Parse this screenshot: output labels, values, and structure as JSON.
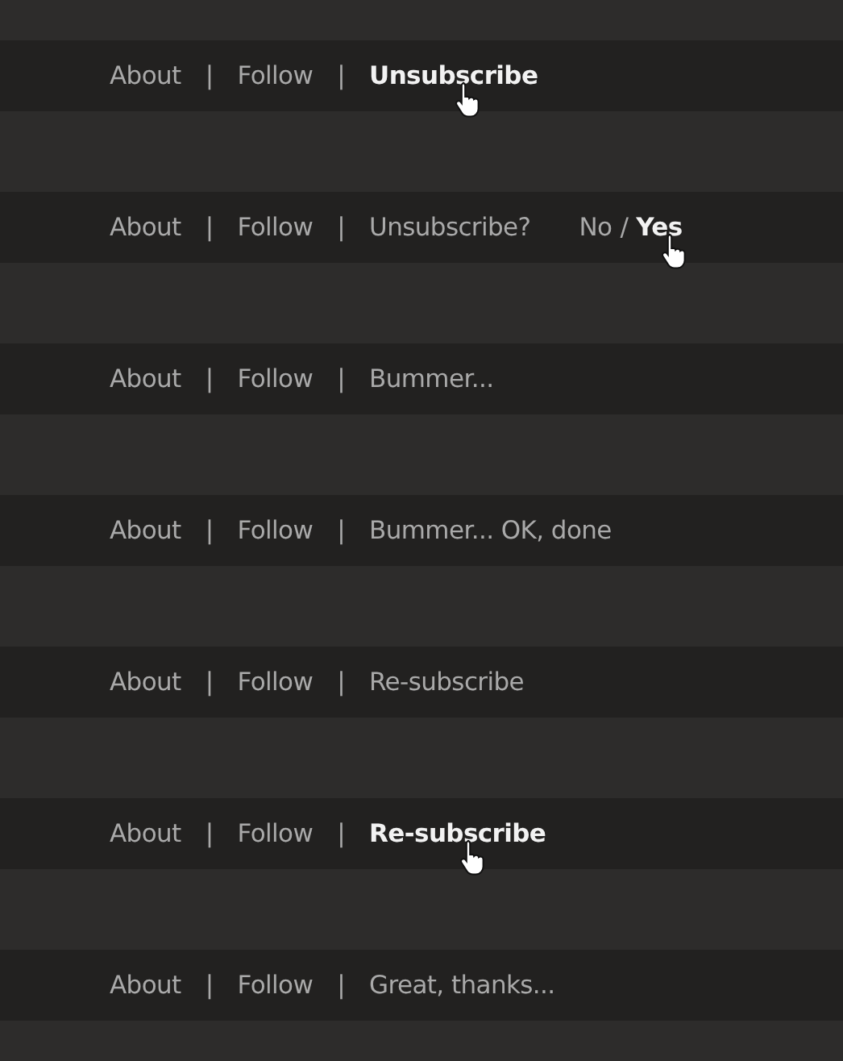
{
  "rows": [
    {
      "items": [
        {
          "kind": "link",
          "label": "About",
          "hovered": false
        },
        {
          "kind": "separator",
          "label": "|"
        },
        {
          "kind": "link",
          "label": "Follow",
          "hovered": false
        },
        {
          "kind": "separator",
          "label": "|"
        },
        {
          "kind": "link",
          "label": "Unsubscribe",
          "hovered": true
        }
      ]
    },
    {
      "items": [
        {
          "kind": "link",
          "label": "About",
          "hovered": false
        },
        {
          "kind": "separator",
          "label": "|"
        },
        {
          "kind": "link",
          "label": "Follow",
          "hovered": false
        },
        {
          "kind": "separator",
          "label": "|"
        },
        {
          "kind": "text",
          "label": "Unsubscribe?"
        },
        {
          "kind": "spacer"
        },
        {
          "kind": "link",
          "label": "No",
          "hovered": false
        },
        {
          "kind": "slash",
          "label": "/"
        },
        {
          "kind": "link",
          "label": "Yes",
          "hovered": true
        }
      ]
    },
    {
      "items": [
        {
          "kind": "link",
          "label": "About",
          "hovered": false
        },
        {
          "kind": "separator",
          "label": "|"
        },
        {
          "kind": "link",
          "label": "Follow",
          "hovered": false
        },
        {
          "kind": "separator",
          "label": "|"
        },
        {
          "kind": "text",
          "label": "Bummer..."
        }
      ]
    },
    {
      "items": [
        {
          "kind": "link",
          "label": "About",
          "hovered": false
        },
        {
          "kind": "separator",
          "label": "|"
        },
        {
          "kind": "link",
          "label": "Follow",
          "hovered": false
        },
        {
          "kind": "separator",
          "label": "|"
        },
        {
          "kind": "text",
          "label": "Bummer... OK, done"
        }
      ]
    },
    {
      "items": [
        {
          "kind": "link",
          "label": "About",
          "hovered": false
        },
        {
          "kind": "separator",
          "label": "|"
        },
        {
          "kind": "link",
          "label": "Follow",
          "hovered": false
        },
        {
          "kind": "separator",
          "label": "|"
        },
        {
          "kind": "link",
          "label": "Re-subscribe",
          "hovered": false
        }
      ]
    },
    {
      "items": [
        {
          "kind": "link",
          "label": "About",
          "hovered": false
        },
        {
          "kind": "separator",
          "label": "|"
        },
        {
          "kind": "link",
          "label": "Follow",
          "hovered": false
        },
        {
          "kind": "separator",
          "label": "|"
        },
        {
          "kind": "link",
          "label": "Re-subscribe",
          "hovered": true
        }
      ]
    },
    {
      "items": [
        {
          "kind": "link",
          "label": "About",
          "hovered": false
        },
        {
          "kind": "separator",
          "label": "|"
        },
        {
          "kind": "link",
          "label": "Follow",
          "hovered": false
        },
        {
          "kind": "separator",
          "label": "|"
        },
        {
          "kind": "text",
          "label": "Great, thanks..."
        }
      ]
    }
  ]
}
